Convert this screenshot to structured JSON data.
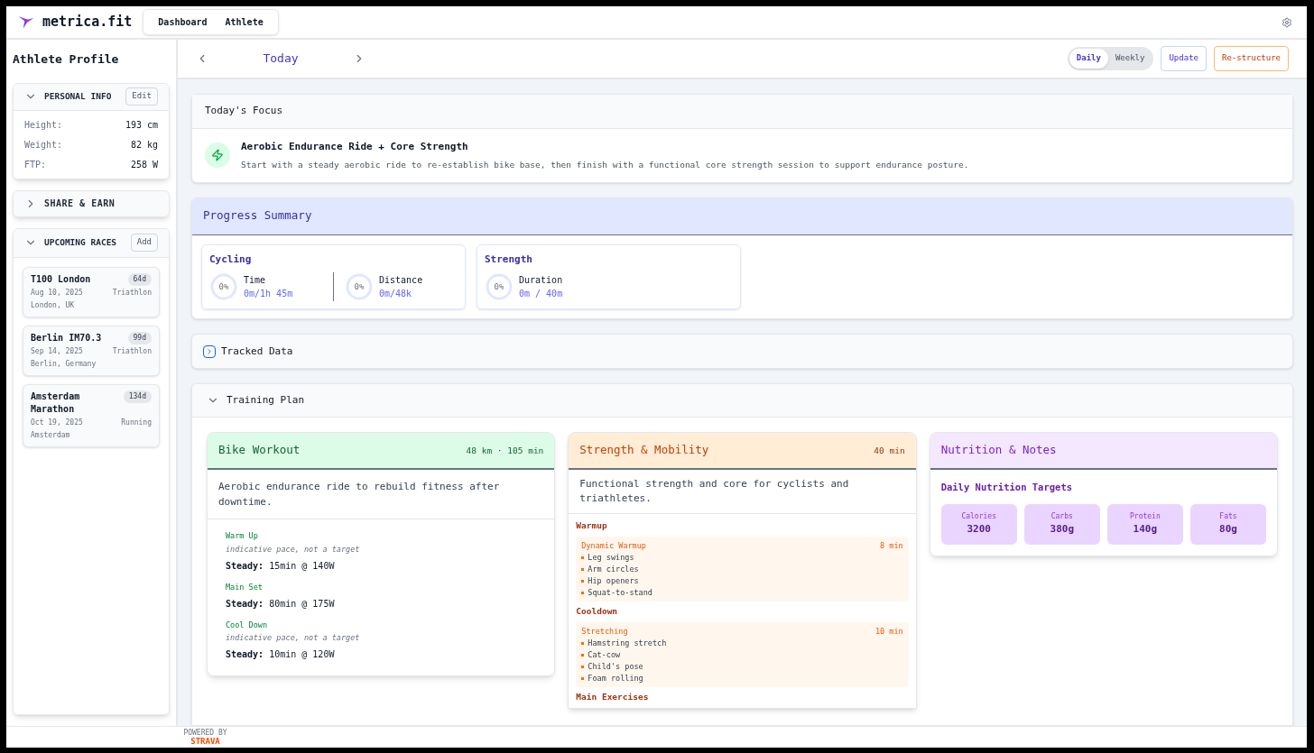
{
  "brand": {
    "name": "metrica.fit"
  },
  "nav": [
    {
      "label": "Dashboard"
    },
    {
      "label": "Athlete"
    }
  ],
  "sidebar": {
    "title": "Athlete Profile",
    "personal_info": {
      "title": "PERSONAL INFO",
      "expanded": true,
      "action": "Edit",
      "fields": [
        {
          "label": "Height:",
          "value": "193 cm"
        },
        {
          "label": "Weight:",
          "value": "82 kg"
        },
        {
          "label": "FTP:",
          "value": "258 W"
        }
      ]
    },
    "share": {
      "title": "SHARE & EARN",
      "expanded": false
    },
    "races": {
      "title": "UPCOMING RACES",
      "expanded": true,
      "action": "Add",
      "items": [
        {
          "name": "T100 London",
          "countdown": "64d",
          "date": "Aug 10, 2025",
          "type": "Triathlon",
          "location": "London, UK"
        },
        {
          "name": "Berlin IM70.3",
          "countdown": "99d",
          "date": "Sep 14, 2025",
          "type": "Triathlon",
          "location": "Berlin, Germany"
        },
        {
          "name": "Amsterdam Marathon",
          "countdown": "134d",
          "date": "Oct 19, 2025",
          "type": "Running",
          "location": "Amsterdam"
        }
      ]
    }
  },
  "date_nav": {
    "label": "Today"
  },
  "view_toggle": [
    {
      "label": "Daily",
      "selected": true
    },
    {
      "label": "Weekly",
      "selected": false
    }
  ],
  "actions": [
    {
      "label": "Update",
      "kind": "primary"
    },
    {
      "label": "Re-structure",
      "kind": "warning"
    }
  ],
  "focus": {
    "title": "Today's Focus",
    "headline": "Aerobic Endurance Ride + Core Strength",
    "description": "Start with a steady aerobic ride to re-establish bike base, then finish with a functional core strength session to support endurance posture."
  },
  "progress": {
    "title": "Progress Summary",
    "groups": [
      {
        "title": "Cycling",
        "metrics": [
          {
            "label": "Time",
            "percent": "0%",
            "value": "0m/1h 45m",
            "level": 0
          },
          {
            "label": "Distance",
            "percent": "0%",
            "value": "0m/48k",
            "level": 0
          }
        ]
      },
      {
        "title": "Strength",
        "metrics": [
          {
            "label": "Duration",
            "percent": "0%",
            "value": "0m / 40m",
            "level": 0
          }
        ]
      }
    ]
  },
  "tracked": {
    "title": "Tracked Data",
    "expanded": false
  },
  "plan": {
    "title": "Training Plan",
    "expanded": true,
    "bike": {
      "title": "Bike Workout",
      "meta": "48 km · 105 min",
      "description": "Aerobic endurance ride to rebuild fitness after downtime.",
      "steps": [
        {
          "name": "Warm Up",
          "note": "indicative pace, not a target",
          "label": "Steady:",
          "target": "15min @ 140W"
        },
        {
          "name": "Main Set",
          "label": "Steady:",
          "target": "80min @ 175W"
        },
        {
          "name": "Cool Down",
          "note": "indicative pace, not a target",
          "label": "Steady:",
          "target": "10min @ 120W"
        }
      ]
    },
    "strength": {
      "title": "Strength & Mobility",
      "meta": "40 min",
      "description": "Functional strength and core for cyclists and triathletes.",
      "sections": [
        {
          "title": "Warmup",
          "blocks": [
            {
              "name": "Dynamic Warmup",
              "duration": "8 min",
              "items": [
                "Leg swings",
                "Arm circles",
                "Hip openers",
                "Squat-to-stand"
              ]
            }
          ]
        },
        {
          "title": "Cooldown",
          "blocks": [
            {
              "name": "Stretching",
              "duration": "10 min",
              "items": [
                "Hamstring stretch",
                "Cat-cow",
                "Child's pose",
                "Foam rolling"
              ]
            }
          ]
        },
        {
          "title": "Main Exercises"
        }
      ]
    },
    "nutrition": {
      "title": "Nutrition & Notes",
      "subtitle": "Daily Nutrition Targets",
      "targets": [
        {
          "label": "Calories",
          "value": "3200"
        },
        {
          "label": "Carbs",
          "value": "380g"
        },
        {
          "label": "Protein",
          "value": "140g"
        },
        {
          "label": "Fats",
          "value": "80g"
        }
      ]
    }
  },
  "footer": {
    "powered": "POWERED BY",
    "brand": "STRAVA"
  }
}
